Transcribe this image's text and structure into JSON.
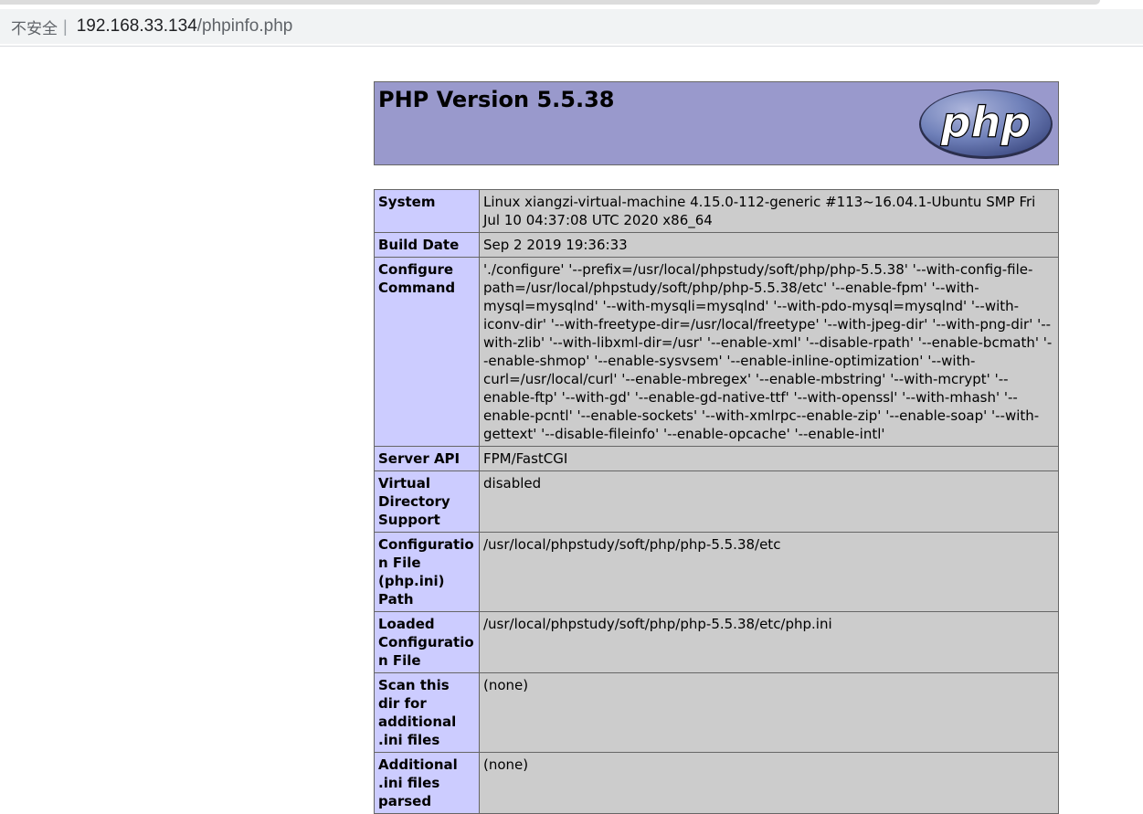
{
  "browser": {
    "security_label": "不安全",
    "separator": "|",
    "url_host": "192.168.33.134",
    "url_path": "/phpinfo.php"
  },
  "header": {
    "title": "PHP Version 5.5.38",
    "logo_text": "php"
  },
  "rows": [
    {
      "key": "System",
      "value": "Linux xiangzi-virtual-machine 4.15.0-112-generic #113~16.04.1-Ubuntu SMP Fri Jul 10 04:37:08 UTC 2020 x86_64"
    },
    {
      "key": "Build Date",
      "value": "Sep 2 2019 19:36:33"
    },
    {
      "key": "Configure Command",
      "value": "'./configure' '--prefix=/usr/local/phpstudy/soft/php/php-5.5.38' '--with-config-file-path=/usr/local/phpstudy/soft/php/php-5.5.38/etc' '--enable-fpm' '--with-mysql=mysqlnd' '--with-mysqli=mysqlnd' '--with-pdo-mysql=mysqlnd' '--with-iconv-dir' '--with-freetype-dir=/usr/local/freetype' '--with-jpeg-dir' '--with-png-dir' '--with-zlib' '--with-libxml-dir=/usr' '--enable-xml' '--disable-rpath' '--enable-bcmath' '--enable-shmop' '--enable-sysvsem' '--enable-inline-optimization' '--with-curl=/usr/local/curl' '--enable-mbregex' '--enable-mbstring' '--with-mcrypt' '--enable-ftp' '--with-gd' '--enable-gd-native-ttf' '--with-openssl' '--with-mhash' '--enable-pcntl' '--enable-sockets' '--with-xmlrpc--enable-zip' '--enable-soap' '--with-gettext' '--disable-fileinfo' '--enable-opcache' '--enable-intl'"
    },
    {
      "key": "Server API",
      "value": "FPM/FastCGI"
    },
    {
      "key": "Virtual Directory Support",
      "value": "disabled"
    },
    {
      "key": "Configuration File (php.ini) Path",
      "value": "/usr/local/phpstudy/soft/php/php-5.5.38/etc"
    },
    {
      "key": "Loaded Configuration File",
      "value": "/usr/local/phpstudy/soft/php/php-5.5.38/etc/php.ini"
    },
    {
      "key": "Scan this dir for additional .ini files",
      "value": "(none)"
    },
    {
      "key": "Additional .ini files parsed",
      "value": "(none)"
    }
  ],
  "colors": {
    "header_bg": "#9999cc",
    "key_cell_bg": "#ccccff",
    "value_cell_bg": "#cccccc",
    "border": "#666666",
    "logo_bg": "#6c7eb7"
  }
}
